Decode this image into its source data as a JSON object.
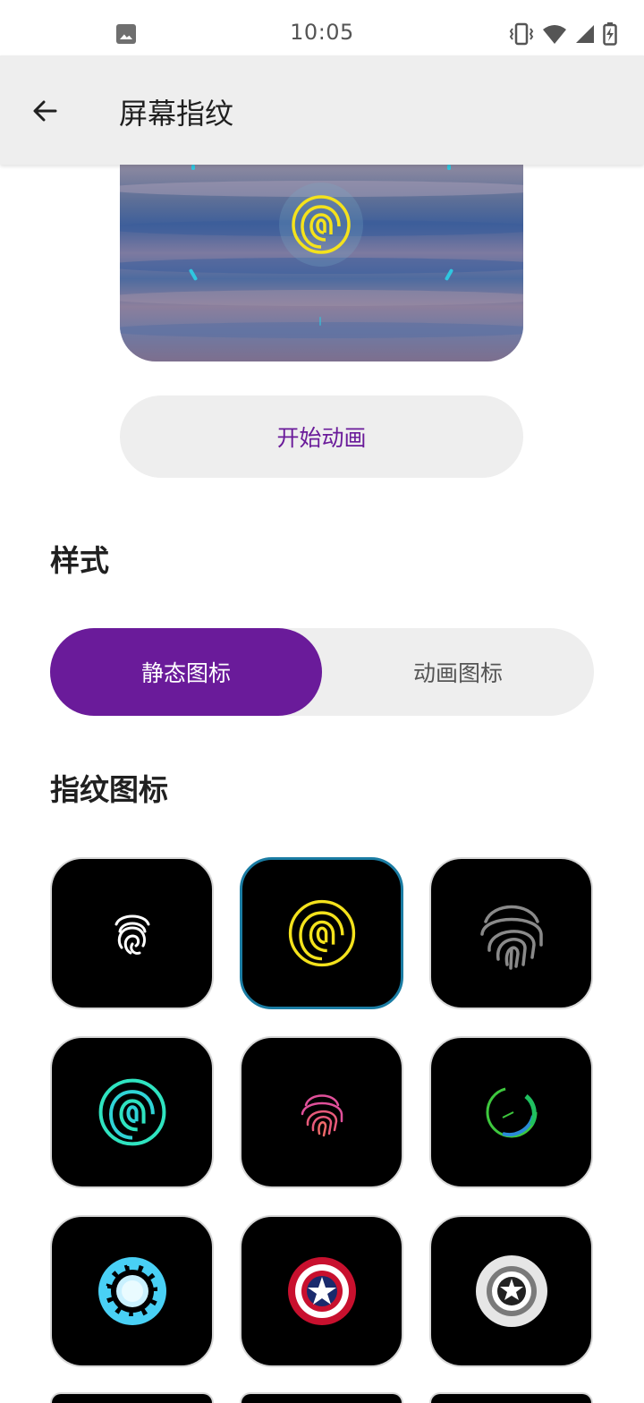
{
  "status_bar": {
    "time": "10:05"
  },
  "app_bar": {
    "title": "屏幕指纹"
  },
  "preview": {
    "animation_button_label": "开始动画"
  },
  "style_section": {
    "title": "样式",
    "segments": [
      "静态图标",
      "动画图标"
    ],
    "selected_segment": "静态图标"
  },
  "icons_section": {
    "title": "指纹图标",
    "icons": [
      {
        "name": "white-fingerprint-icon",
        "color": "#ffffff"
      },
      {
        "name": "yellow-at-fingerprint-icon",
        "color": "#f4e21c",
        "selected": true
      },
      {
        "name": "gray-fingerprint-icon",
        "color": "#8a8a8a"
      },
      {
        "name": "teal-at-fingerprint-icon",
        "color": "#2fe3c0"
      },
      {
        "name": "pink-fingerprint-icon",
        "color": "#e0509a"
      },
      {
        "name": "green-ring-icon",
        "color": "#3ec83e"
      },
      {
        "name": "arc-reactor-icon",
        "color": "#49d0f5"
      },
      {
        "name": "captain-shield-icon",
        "color": "#c8102e"
      },
      {
        "name": "gray-shield-icon",
        "color": "#9a9a9a"
      }
    ]
  },
  "colors": {
    "accent": "#6a1b9a",
    "selected_border": "#1a7ca3"
  }
}
